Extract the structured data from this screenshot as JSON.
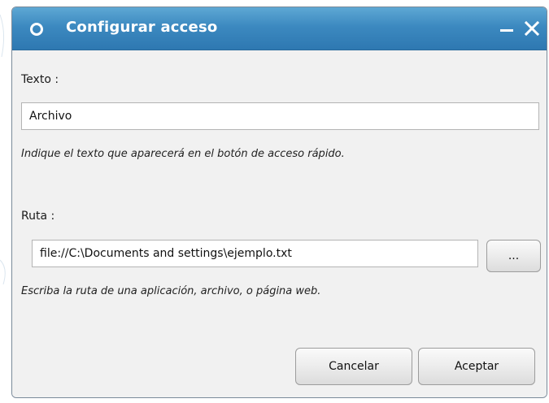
{
  "dialog": {
    "title": "Configurar acceso",
    "app_icon": "circle-o-icon",
    "minimize_icon": "minimize-icon",
    "close_icon": "close-icon"
  },
  "text_field": {
    "label": "Texto :",
    "value": "Archivo",
    "hint": "Indique el texto que aparecerá en el botón de acceso rápido."
  },
  "path_field": {
    "label": "Ruta :",
    "value": "file://C:\\Documents and settings\\ejemplo.txt",
    "hint": "Escriba la ruta de una aplicación, archivo, o página web.",
    "browse_label": "..."
  },
  "buttons": {
    "cancel_label": "Cancelar",
    "accept_label": "Aceptar"
  },
  "colors": {
    "titlebar": "#3c89c0",
    "title_text": "#ffffff",
    "content_bg": "#f1f1f1"
  }
}
